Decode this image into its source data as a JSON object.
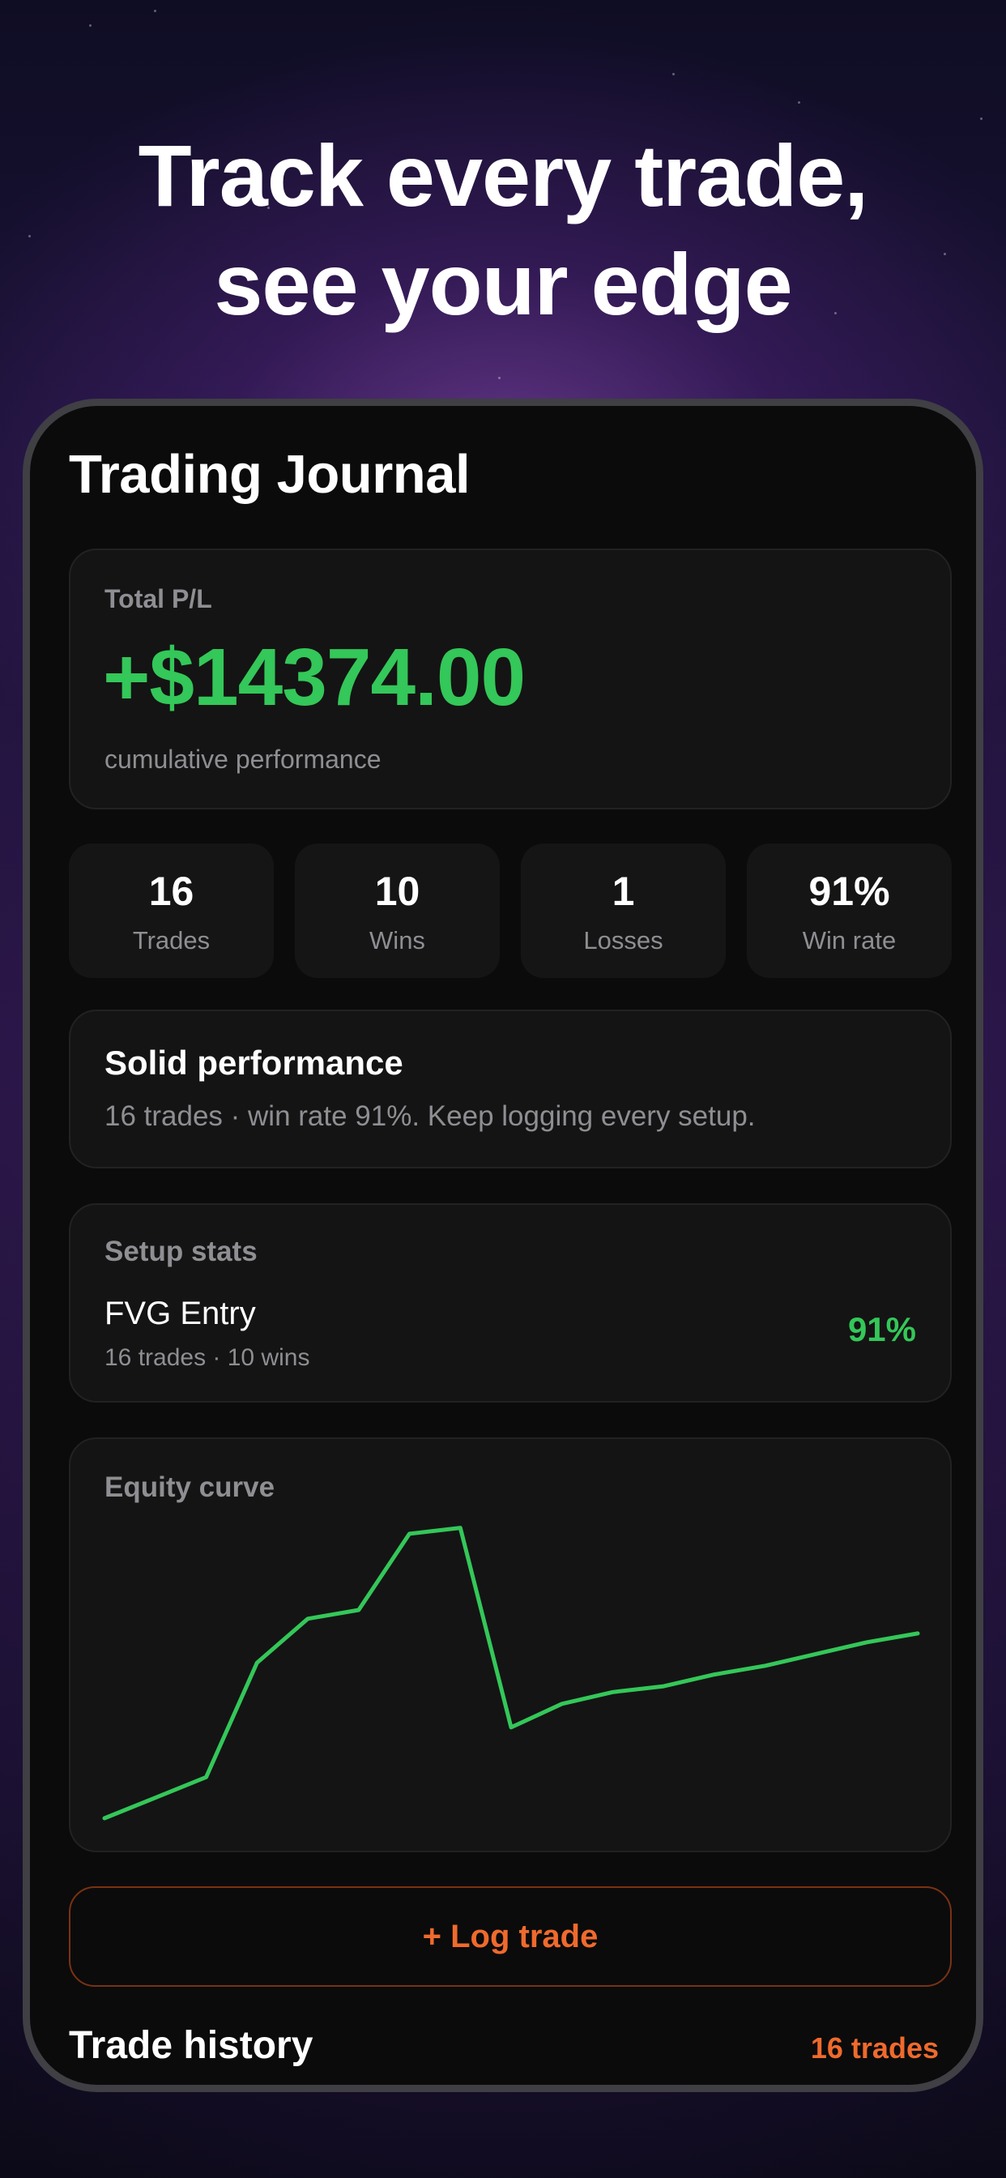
{
  "headline": {
    "line1": "Track every trade,",
    "line2": "see your edge"
  },
  "app": {
    "title": "Trading Journal"
  },
  "total_pl": {
    "label": "Total P/L",
    "value": "+$14374.00",
    "subtitle": "cumulative performance"
  },
  "stats": [
    {
      "value": "16",
      "label": "Trades"
    },
    {
      "value": "10",
      "label": "Wins"
    },
    {
      "value": "1",
      "label": "Losses"
    },
    {
      "value": "91%",
      "label": "Win rate"
    }
  ],
  "performance": {
    "title": "Solid performance",
    "text": "16 trades · win rate 91%. Keep logging every setup."
  },
  "setup_stats": {
    "heading": "Setup stats",
    "items": [
      {
        "name": "FVG Entry",
        "meta": "16 trades · 10 wins",
        "win_rate": "91%"
      }
    ]
  },
  "equity": {
    "heading": "Equity curve",
    "line_color": "#34c759"
  },
  "chart_data": {
    "type": "line",
    "title": "Equity curve",
    "x": [
      1,
      2,
      3,
      4,
      5,
      6,
      7,
      8,
      9,
      10,
      11,
      12,
      13,
      14,
      15,
      16,
      17
    ],
    "values": [
      0.0,
      0.07,
      0.14,
      0.53,
      0.68,
      0.71,
      0.97,
      0.99,
      0.31,
      0.39,
      0.43,
      0.45,
      0.49,
      0.52,
      0.56,
      0.6,
      0.63
    ],
    "xlabel": "",
    "ylabel": "",
    "ylim": [
      0,
      1
    ],
    "grid": false
  },
  "log_trade": {
    "label": "+ Log trade"
  },
  "history": {
    "title": "Trade history",
    "count": "16 trades"
  },
  "colors": {
    "accent_orange": "#ef6a2c",
    "positive_green": "#34c759",
    "card_bg": "#141414"
  }
}
